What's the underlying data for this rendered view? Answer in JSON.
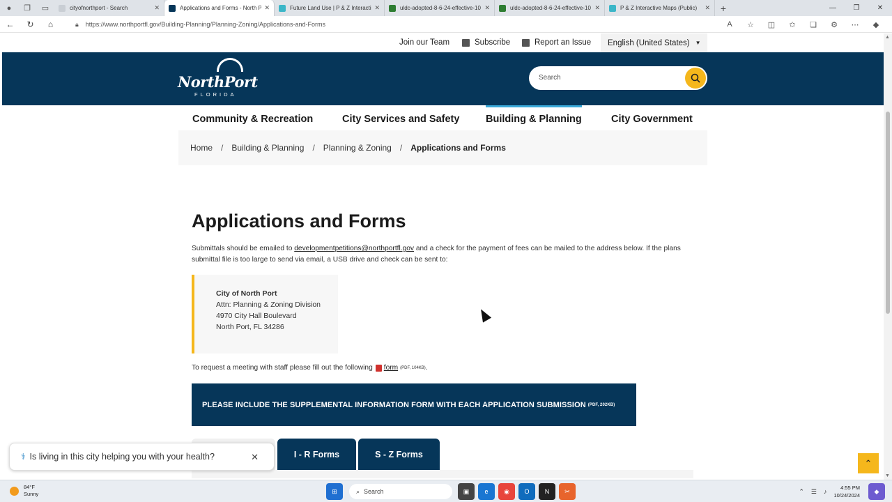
{
  "browser": {
    "tabs": [
      {
        "title": "cityofnorthport - Search",
        "active": false,
        "color": "#dfe3e8"
      },
      {
        "title": "Applications and Forms - North P",
        "active": true,
        "color": "#063659"
      },
      {
        "title": "Future Land Use | P & Z Interacti",
        "active": false,
        "color": "#3bb6c8"
      },
      {
        "title": "uldc-adopted-8-6-24-effective-10",
        "active": false,
        "color": "#2e7d32"
      },
      {
        "title": "uldc-adopted-8-6-24-effective-10",
        "active": false,
        "color": "#2e7d32"
      },
      {
        "title": "P & Z Interactive Maps (Public)",
        "active": false,
        "color": "#3bb6c8"
      }
    ],
    "url": "https://www.northportfl.gov/Building-Planning/Planning-Zoning/Applications-and-Forms"
  },
  "utility": {
    "join": "Join our Team",
    "subscribe": "Subscribe",
    "report": "Report an Issue",
    "language": "English (United States)"
  },
  "header": {
    "logo_main": "NorthPort",
    "logo_sub": "FLORIDA",
    "search_placeholder": "Search"
  },
  "nav": {
    "items": [
      "Community & Recreation",
      "City Services and Safety",
      "Building & Planning",
      "City Government"
    ],
    "active": "Building & Planning"
  },
  "breadcrumb": {
    "home": "Home",
    "level1": "Building & Planning",
    "level2": "Planning & Zoning",
    "current": "Applications and Forms"
  },
  "content": {
    "title": "Applications and Forms",
    "intro_before": "Submittals should be emailed to ",
    "intro_email": "developmentpetitions@northportfl.gov",
    "intro_after": " and a check for the payment of fees can be mailed to the address below. If the plans submittal file is too large to send via email, a USB drive and check can be sent to:",
    "address": {
      "name": "City of North Port",
      "attn": "Attn: Planning & Zoning Division",
      "street": "4970 City Hall Boulevard",
      "city": "North Port, FL 34286"
    },
    "meeting_text": "To request a meeting with staff please fill out the following ",
    "meeting_link": "form",
    "meeting_meta": "(PDF, 104KB)",
    "banner_text": "PLEASE INCLUDE THE SUPPLEMENTAL INFORMATION FORM WITH EACH APPLICATION SUBMISSION",
    "banner_meta": "(PDF, 202KB)",
    "form_tabs": [
      "I - R Forms",
      "S - Z Forms"
    ]
  },
  "survey": {
    "question": "Is living in this city helping you with your health?"
  },
  "taskbar": {
    "temp": "84°F",
    "condition": "Sunny",
    "search": "Search",
    "time": "4:55 PM",
    "date": "10/24/2024"
  },
  "colors": {
    "navy": "#063659",
    "accent": "#f5b71c",
    "nav_active": "#3aa9d9"
  }
}
